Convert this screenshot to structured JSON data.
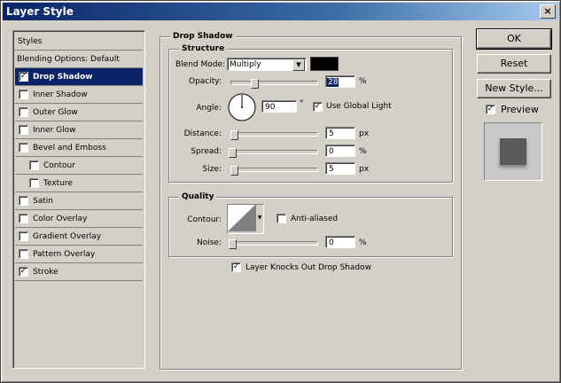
{
  "window": {
    "title": "Layer Style",
    "close_glyph": "×"
  },
  "styles_list": {
    "header": "Styles",
    "items": [
      {
        "label": "Blending Options: Default",
        "checkbox": false,
        "checked": false,
        "selected": false
      },
      {
        "label": "Drop Shadow",
        "checkbox": true,
        "checked": true,
        "selected": true
      },
      {
        "label": "Inner Shadow",
        "checkbox": true,
        "checked": false,
        "selected": false
      },
      {
        "label": "Outer Glow",
        "checkbox": true,
        "checked": false,
        "selected": false
      },
      {
        "label": "Inner Glow",
        "checkbox": true,
        "checked": false,
        "selected": false
      },
      {
        "label": "Bevel and Emboss",
        "checkbox": true,
        "checked": false,
        "selected": false
      },
      {
        "label": "Contour",
        "checkbox": true,
        "checked": false,
        "selected": false,
        "indent": true
      },
      {
        "label": "Texture",
        "checkbox": true,
        "checked": false,
        "selected": false,
        "indent": true
      },
      {
        "label": "Satin",
        "checkbox": true,
        "checked": false,
        "selected": false
      },
      {
        "label": "Color Overlay",
        "checkbox": true,
        "checked": false,
        "selected": false
      },
      {
        "label": "Gradient Overlay",
        "checkbox": true,
        "checked": false,
        "selected": false
      },
      {
        "label": "Pattern Overlay",
        "checkbox": true,
        "checked": false,
        "selected": false
      },
      {
        "label": "Stroke",
        "checkbox": true,
        "checked": true,
        "selected": false
      }
    ]
  },
  "drop_shadow": {
    "group_title": "Drop Shadow",
    "structure": {
      "title": "Structure",
      "blend_mode_label": "Blend Mode:",
      "blend_mode_value": "Multiply",
      "shadow_color": "#000000",
      "opacity_label": "Opacity:",
      "opacity_value": "28",
      "opacity_unit": "%",
      "angle_label": "Angle:",
      "angle_value": "90",
      "angle_unit": "°",
      "use_global_light_label": "Use Global Light",
      "use_global_light_checked": true,
      "distance_label": "Distance:",
      "distance_value": "5",
      "distance_unit": "px",
      "spread_label": "Spread:",
      "spread_value": "0",
      "spread_unit": "%",
      "size_label": "Size:",
      "size_value": "5",
      "size_unit": "px"
    },
    "quality": {
      "title": "Quality",
      "contour_label": "Contour:",
      "anti_aliased_label": "Anti-aliased",
      "anti_aliased_checked": false,
      "noise_label": "Noise:",
      "noise_value": "0",
      "noise_unit": "%"
    },
    "knockout_label": "Layer Knocks Out Drop Shadow",
    "knockout_checked": true
  },
  "buttons": {
    "ok": "OK",
    "reset": "Reset",
    "new_style": "New Style..."
  },
  "preview": {
    "label": "Preview",
    "checked": true
  },
  "check_glyph": "✓"
}
